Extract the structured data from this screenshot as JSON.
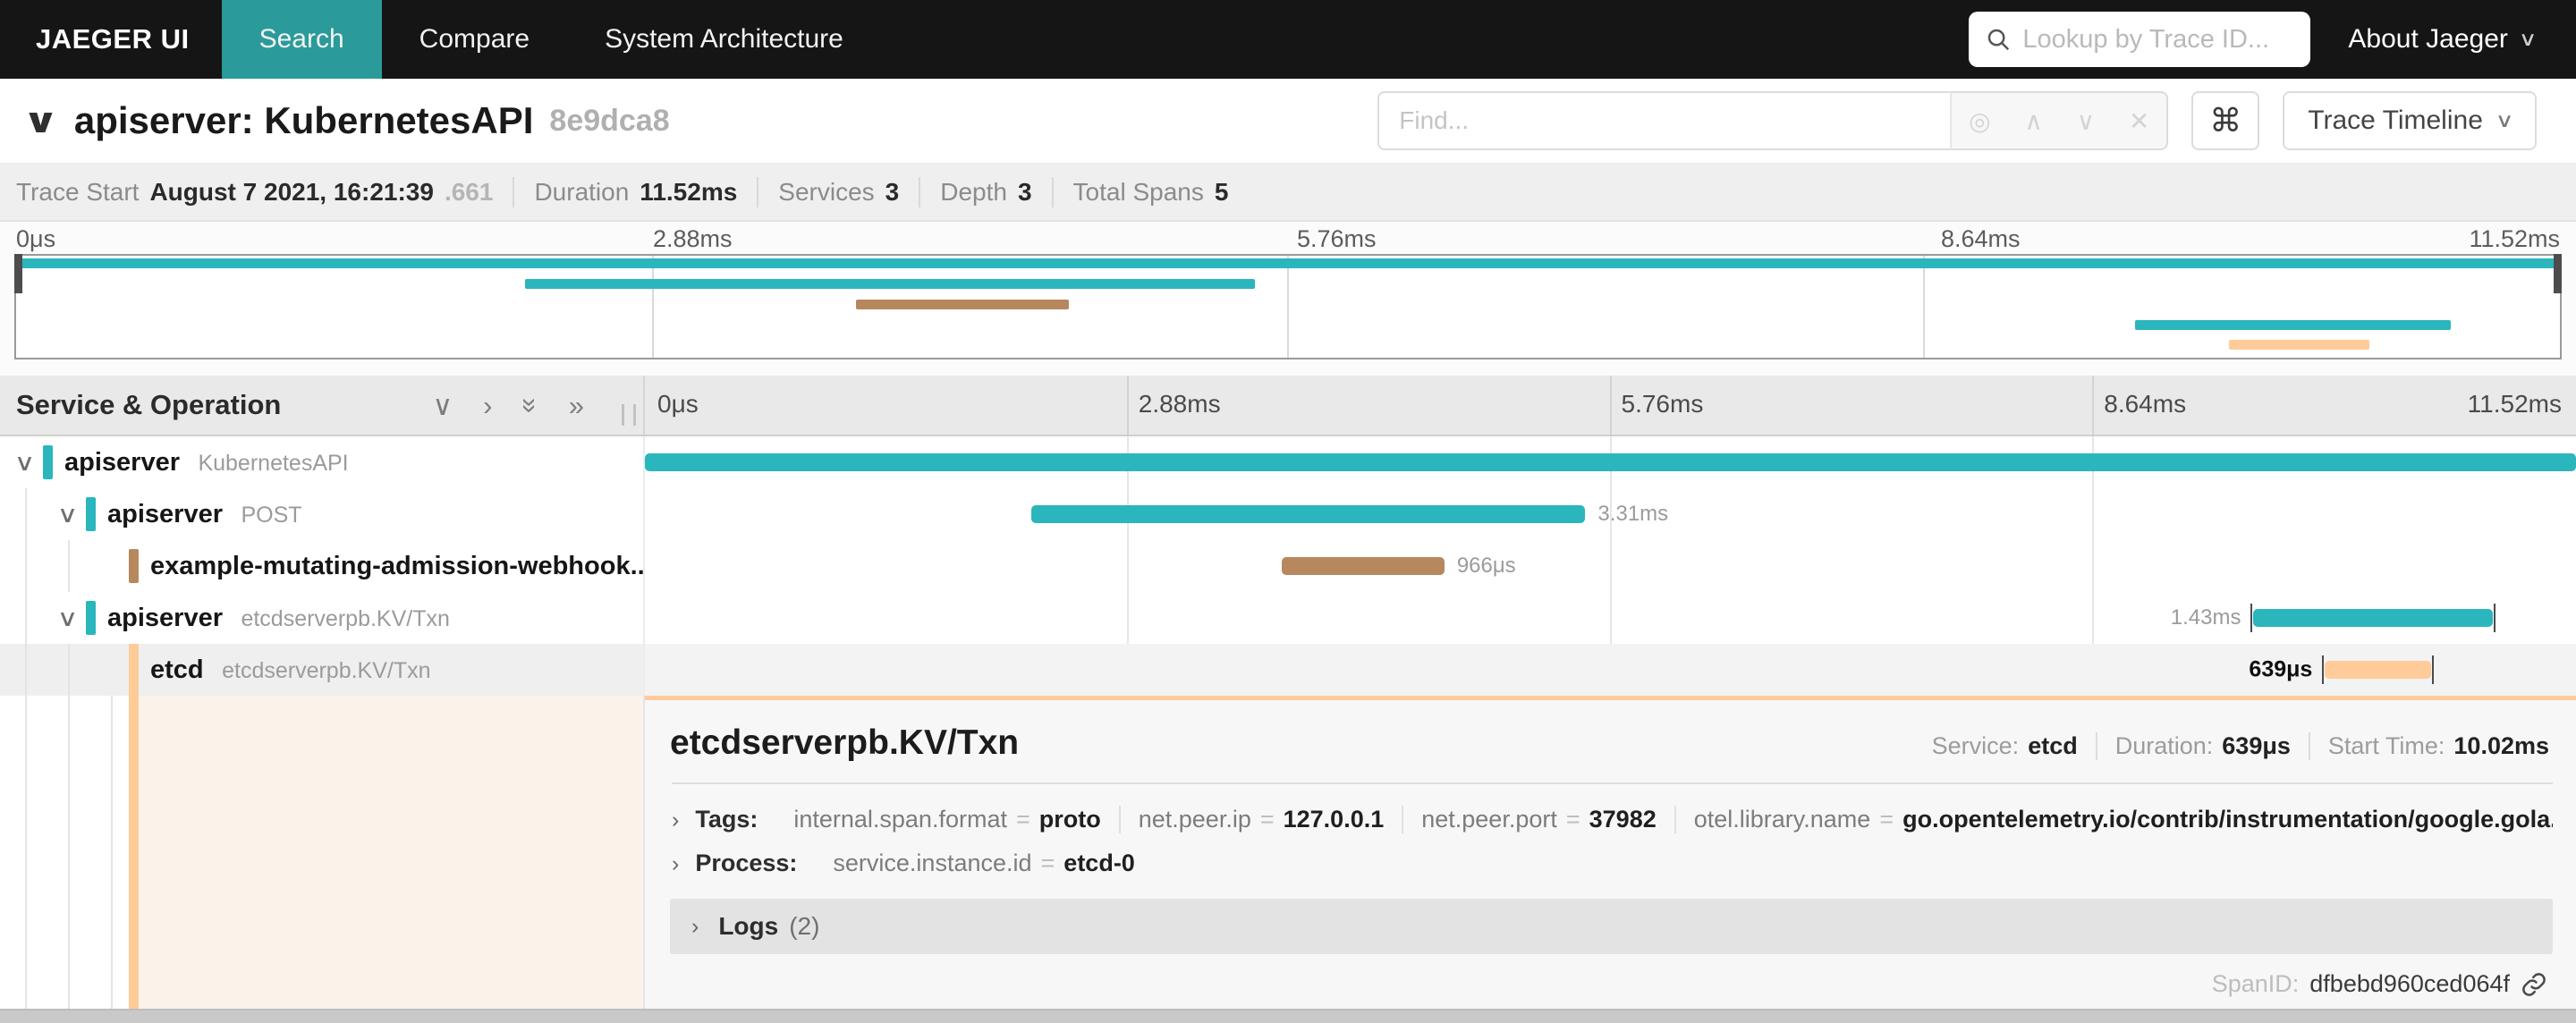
{
  "nav": {
    "brand": "JAEGER UI",
    "items": [
      {
        "label": "Search",
        "active": true
      },
      {
        "label": "Compare",
        "active": false
      },
      {
        "label": "System Architecture",
        "active": false
      }
    ],
    "lookup_placeholder": "Lookup by Trace ID...",
    "about_label": "About Jaeger"
  },
  "trace_header": {
    "title": "apiserver: KubernetesAPI",
    "trace_id": "8e9dca8",
    "find_placeholder": "Find...",
    "view_button": "Trace Timeline"
  },
  "summary": {
    "trace_start_label": "Trace Start",
    "trace_start_value": "August 7 2021, 16:21:39",
    "trace_start_fraction": ".661",
    "duration_label": "Duration",
    "duration_value": "11.52ms",
    "services_label": "Services",
    "services_value": "3",
    "depth_label": "Depth",
    "depth_value": "3",
    "total_spans_label": "Total Spans",
    "total_spans_value": "5"
  },
  "axis": {
    "ticks": [
      "0μs",
      "2.88ms",
      "5.76ms",
      "8.64ms",
      "11.52ms"
    ]
  },
  "table_header": {
    "title": "Service & Operation"
  },
  "spans": [
    {
      "service": "apiserver",
      "operation": "KubernetesAPI",
      "depth": 0,
      "color": "#2AB6BC",
      "start_pct": 0,
      "end_pct": 100,
      "duration_label": "",
      "label_side": "none",
      "selected": false
    },
    {
      "service": "apiserver",
      "operation": "POST",
      "depth": 1,
      "color": "#2AB6BC",
      "start_pct": 20.0,
      "end_pct": 48.7,
      "duration_label": "3.31ms",
      "label_side": "right",
      "selected": false
    },
    {
      "service": "example-mutating-admission-webhook...",
      "operation": "",
      "depth": 2,
      "color": "#B7885E",
      "start_pct": 33.0,
      "end_pct": 41.4,
      "duration_label": "966μs",
      "label_side": "right",
      "selected": false
    },
    {
      "service": "apiserver",
      "operation": "etcdserverpb.KV/Txn",
      "depth": 1,
      "color": "#2AB6BC",
      "start_pct": 83.3,
      "end_pct": 95.7,
      "duration_label": "1.43ms",
      "label_side": "left",
      "selected": false
    },
    {
      "service": "etcd",
      "operation": "etcdserverpb.KV/Txn",
      "depth": 2,
      "color": "#FFCB99",
      "start_pct": 87.0,
      "end_pct": 92.5,
      "duration_label": "639μs",
      "label_side": "left",
      "selected": true
    }
  ],
  "detail": {
    "title": "etcdserverpb.KV/Txn",
    "service_label": "Service:",
    "service_value": "etcd",
    "duration_label": "Duration:",
    "duration_value": "639μs",
    "start_time_label": "Start Time:",
    "start_time_value": "10.02ms",
    "tags_label": "Tags:",
    "tags": [
      {
        "key": "internal.span.format",
        "value": "proto"
      },
      {
        "key": "net.peer.ip",
        "value": "127.0.0.1"
      },
      {
        "key": "net.peer.port",
        "value": "37982"
      },
      {
        "key": "otel.library.name",
        "value": "go.opentelemetry.io/contrib/instrumentation/google.gola..."
      }
    ],
    "process_label": "Process:",
    "process_key": "service.instance.id",
    "process_value": "etcd-0",
    "logs_label": "Logs",
    "logs_count": "(2)",
    "span_id_label": "SpanID:",
    "span_id": "dfbebd960ced064f"
  },
  "glyphs": {
    "chevron_down": "∨",
    "chevron_up": "∧",
    "chevron_right": "›",
    "double_chevron_right": "»",
    "command": "⌘",
    "crosshair": "◎",
    "close": "✕",
    "equals": "="
  },
  "colors": {
    "accent_teal": "#2AB6BC",
    "accent_brown": "#B7885E",
    "accent_peach": "#FFCB99",
    "nav_active": "#2B9A9A",
    "nav_bg": "#151515"
  }
}
